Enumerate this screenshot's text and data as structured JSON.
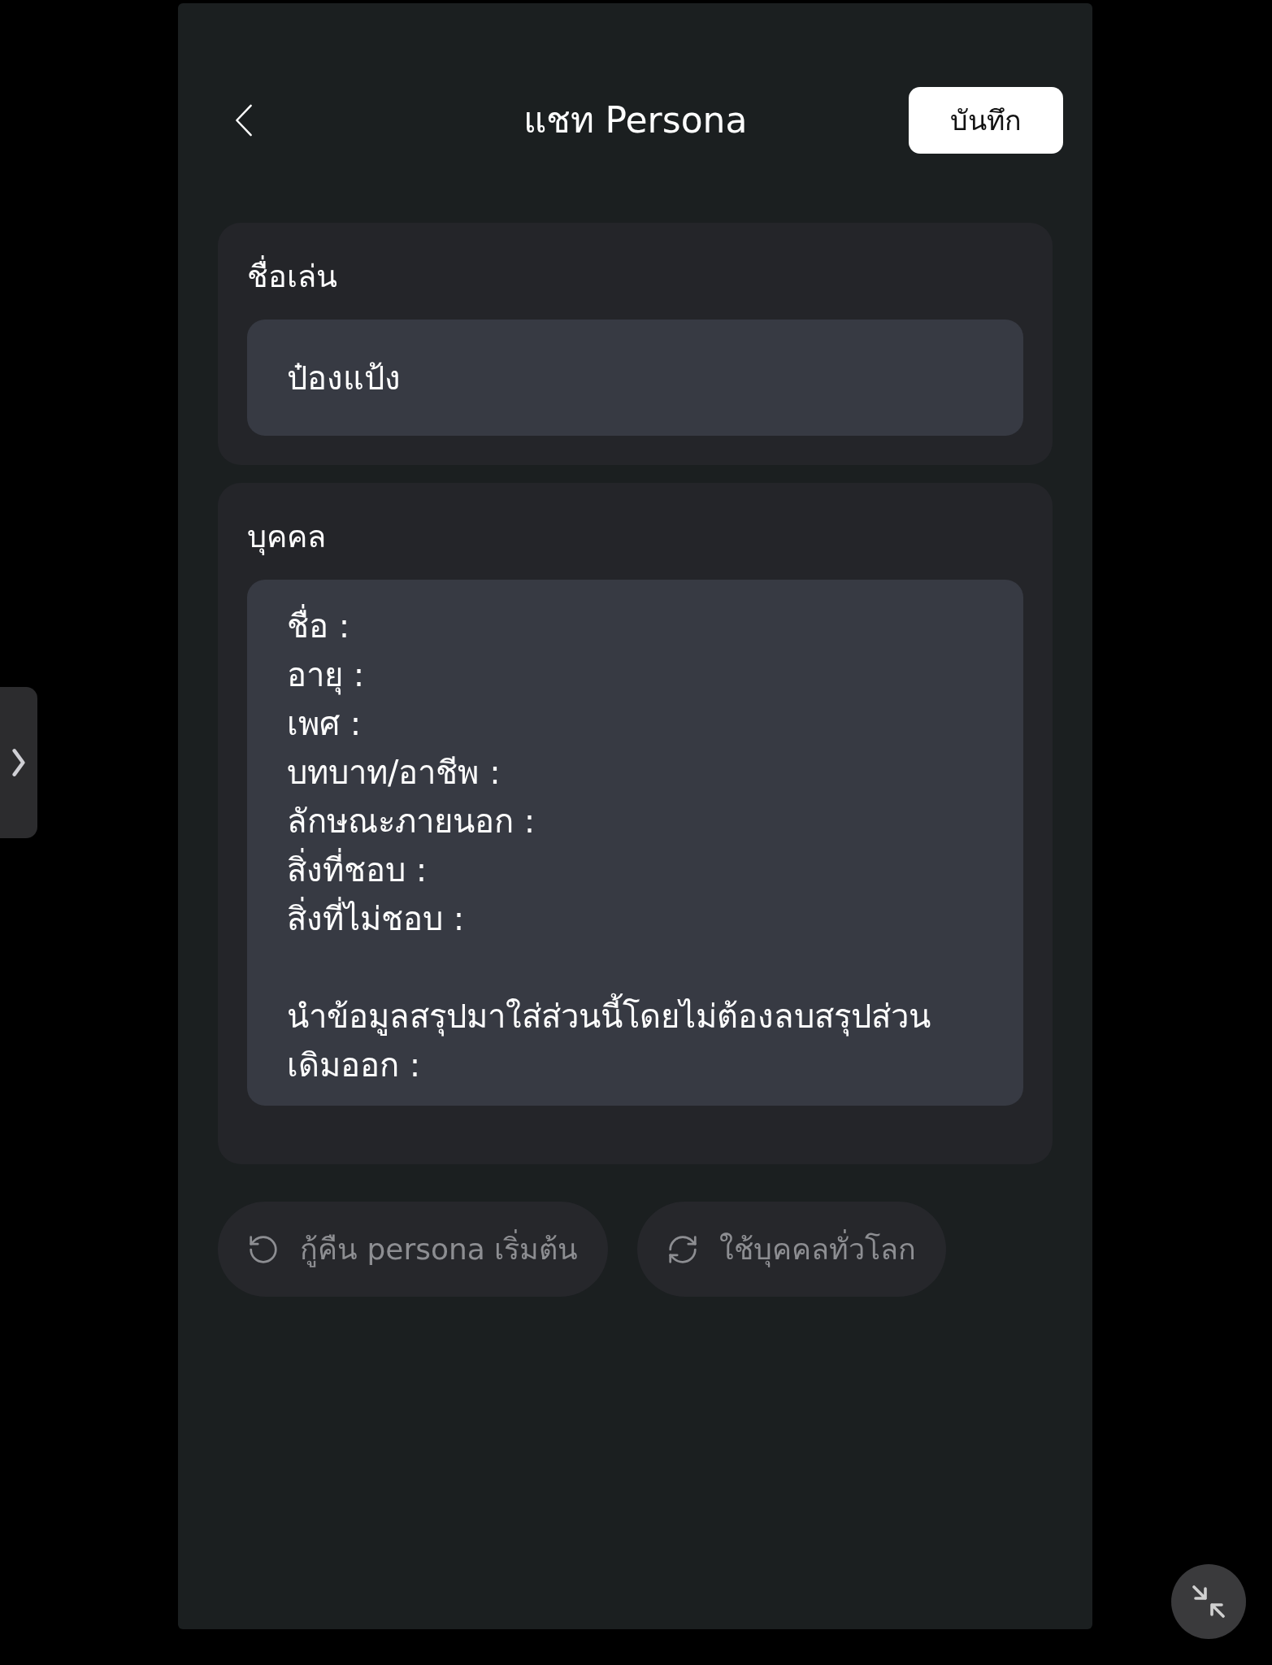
{
  "header": {
    "title": "แชท Persona",
    "save_button": "บันทึก"
  },
  "sections": [
    {
      "label": "ชื่อเล่น",
      "kind": "input",
      "value": "ป๋องแป้ง"
    },
    {
      "label": "บุคคล",
      "kind": "textarea",
      "value": "ชื่อ :\nอายุ :\nเพศ :\nบทบาท/อาชีพ :\nลักษณะภายนอก :\nสิ่งที่ชอบ :\nสิ่งที่ไม่ชอบ :\n\nนำข้อมูลสรุปมาใส่ส่วนนี้โดยไม่ต้องลบสรุปส่วนเดิมออก :"
    }
  ],
  "actions": [
    {
      "label": "กู้คืน persona เริ่มต้น",
      "kind": "reset",
      "disabled": true
    },
    {
      "label": "ใช้บุคคลทั่วโลก",
      "kind": "sync",
      "disabled": true
    }
  ]
}
